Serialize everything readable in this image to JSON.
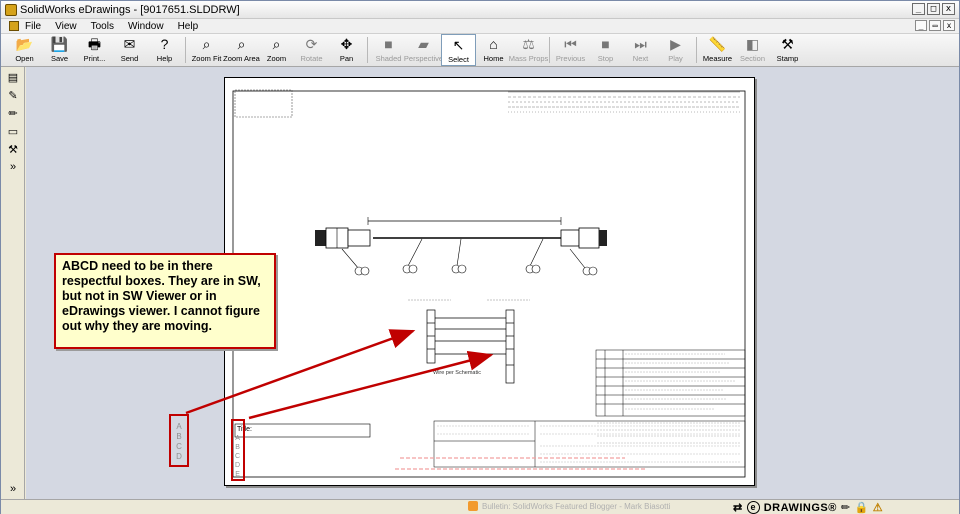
{
  "window": {
    "title": "SolidWorks eDrawings - [9017651.SLDDRW]"
  },
  "menu": [
    "File",
    "View",
    "Tools",
    "Window",
    "Help"
  ],
  "toolbar": [
    {
      "label": "Open",
      "icon": "open-folder-icon",
      "glyph": "📂",
      "disabled": false
    },
    {
      "label": "Save",
      "icon": "save-icon",
      "glyph": "💾",
      "disabled": false
    },
    {
      "label": "Print...",
      "icon": "printer-icon",
      "glyph": "🖶",
      "disabled": false
    },
    {
      "label": "Send",
      "icon": "send-mail-icon",
      "glyph": "✉",
      "disabled": false
    },
    {
      "label": "Help",
      "icon": "help-icon",
      "glyph": "?",
      "disabled": false
    },
    {
      "sep": true
    },
    {
      "label": "Zoom Fit",
      "icon": "zoom-fit-icon",
      "glyph": "⌕",
      "disabled": false
    },
    {
      "label": "Zoom Area",
      "icon": "zoom-area-icon",
      "glyph": "⌕",
      "disabled": false
    },
    {
      "label": "Zoom",
      "icon": "zoom-icon",
      "glyph": "⌕",
      "disabled": false
    },
    {
      "label": "Rotate",
      "icon": "rotate-icon",
      "glyph": "⟳",
      "disabled": true
    },
    {
      "label": "Pan",
      "icon": "pan-icon",
      "glyph": "✥",
      "disabled": false
    },
    {
      "sep": true
    },
    {
      "label": "Shaded",
      "icon": "shaded-icon",
      "glyph": "■",
      "disabled": true
    },
    {
      "label": "Perspective",
      "icon": "perspective-icon",
      "glyph": "▰",
      "disabled": true
    },
    {
      "label": "Select",
      "icon": "select-arrow-icon",
      "glyph": "↖",
      "disabled": false,
      "active": true
    },
    {
      "label": "Home",
      "icon": "home-icon",
      "glyph": "⌂",
      "disabled": false
    },
    {
      "label": "Mass Props",
      "icon": "mass-props-icon",
      "glyph": "⚖",
      "disabled": true
    },
    {
      "sep": true
    },
    {
      "label": "Previous",
      "icon": "previous-icon",
      "glyph": "⏮",
      "disabled": true
    },
    {
      "label": "Stop",
      "icon": "stop-icon",
      "glyph": "■",
      "disabled": true
    },
    {
      "label": "Next",
      "icon": "next-icon",
      "glyph": "⏭",
      "disabled": true
    },
    {
      "label": "Play",
      "icon": "play-icon",
      "glyph": "▶",
      "disabled": true
    },
    {
      "sep": true
    },
    {
      "label": "Measure",
      "icon": "measure-icon",
      "glyph": "📏",
      "disabled": false
    },
    {
      "label": "Section",
      "icon": "section-icon",
      "glyph": "◧",
      "disabled": true
    },
    {
      "label": "Stamp",
      "icon": "stamp-icon",
      "glyph": "⚒",
      "disabled": false
    }
  ],
  "drawing": {
    "title_label": "Title:",
    "letters_left": [
      "A",
      "B",
      "C",
      "D"
    ],
    "letters_sheet": [
      "A",
      "B",
      "C",
      "D",
      "E"
    ],
    "note": "Wire per Schematic"
  },
  "callout": {
    "text": "ABCD need to be in there respectful boxes. They are in SW, but not in SW Viewer or in eDrawings viewer. I cannot figure out why they are moving."
  },
  "statusbar": {
    "bulletin": "Bulletin: SolidWorks Featured Blogger - Mark Biasotti",
    "brand": "DRAWINGS®"
  }
}
